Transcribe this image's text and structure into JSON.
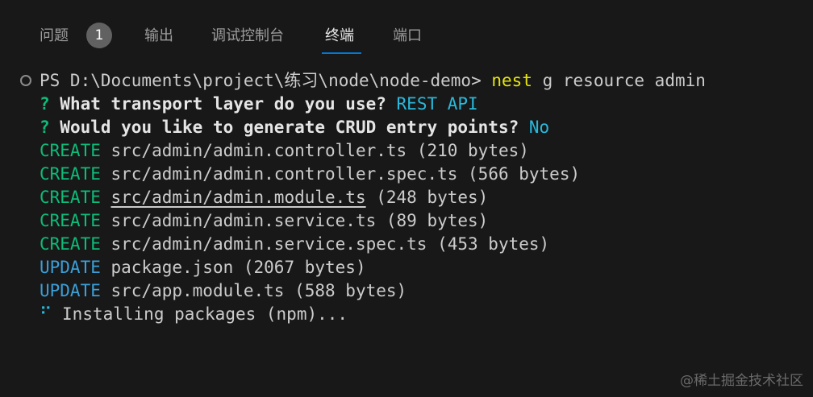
{
  "tabs": [
    {
      "label": "问题",
      "badge": "1"
    },
    {
      "label": "输出"
    },
    {
      "label": "调试控制台"
    },
    {
      "label": "终端",
      "active": true
    },
    {
      "label": "端口"
    }
  ],
  "terminal": {
    "prompt": "PS D:\\Documents\\project\\练习\\node\\node-demo>",
    "command_name": "nest",
    "command_args": " g resource admin",
    "q1_mark": "?",
    "q1_text": " What transport layer do you use?",
    "q1_answer": " REST API",
    "q2_mark": "?",
    "q2_text": " Would you like to generate CRUD entry points?",
    "q2_answer": " No",
    "entries": [
      {
        "action": "CREATE",
        "path": "src/admin/admin.controller.ts",
        "size": " (210 bytes)"
      },
      {
        "action": "CREATE",
        "path": "src/admin/admin.controller.spec.ts",
        "size": " (566 bytes)"
      },
      {
        "action": "CREATE",
        "path": "src/admin/admin.module.ts",
        "size": " (248 bytes)"
      },
      {
        "action": "CREATE",
        "path": "src/admin/admin.service.ts",
        "size": " (89 bytes)"
      },
      {
        "action": "CREATE",
        "path": "src/admin/admin.service.spec.ts",
        "size": " (453 bytes)"
      },
      {
        "action": "UPDATE",
        "path": "package.json",
        "size": " (2067 bytes)"
      },
      {
        "action": "UPDATE",
        "path": "src/app.module.ts",
        "size": " (588 bytes)"
      }
    ],
    "spinner": "⠋",
    "installing": " Installing packages (npm)..."
  },
  "watermark": "@稀土掘金技术社区",
  "colors": {
    "background": "#181818",
    "tab_active_underline": "#0078d4",
    "create": "#0dbc79",
    "update": "#3b9fd8",
    "command": "#e5e510",
    "answer": "#29b8db"
  }
}
